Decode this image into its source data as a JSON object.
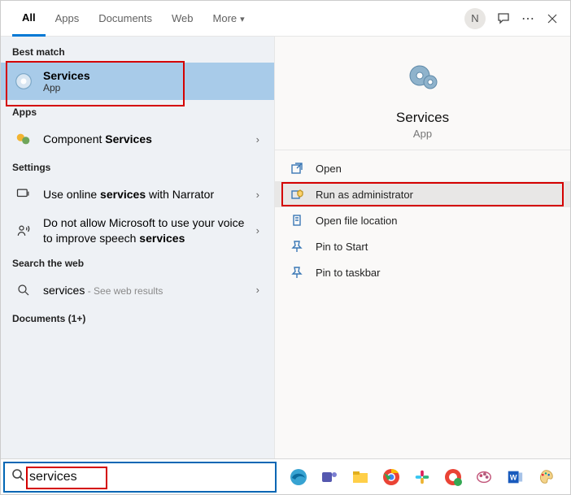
{
  "tabs": {
    "all": "All",
    "apps": "Apps",
    "documents": "Documents",
    "web": "Web",
    "more": "More"
  },
  "user_initial": "N",
  "sections": {
    "best_match": "Best match",
    "apps": "Apps",
    "settings": "Settings",
    "search_web": "Search the web",
    "documents": "Documents (1+)"
  },
  "best_match": {
    "title": "Services",
    "sub": "App"
  },
  "apps_result": {
    "prefix": "Component ",
    "bold": "Services"
  },
  "settings_result_1": {
    "prefix": "Use online ",
    "bold": "services",
    "suffix": " with Narrator"
  },
  "settings_result_2": {
    "prefix": "Do not allow Microsoft to use your voice to improve speech ",
    "bold": "services"
  },
  "web_result": {
    "term": "services",
    "tail": " - See web results"
  },
  "preview": {
    "title": "Services",
    "sub": "App"
  },
  "actions": {
    "open": "Open",
    "run_admin": "Run as administrator",
    "open_loc": "Open file location",
    "pin_start": "Pin to Start",
    "pin_taskbar": "Pin to taskbar"
  },
  "search_value": "services"
}
